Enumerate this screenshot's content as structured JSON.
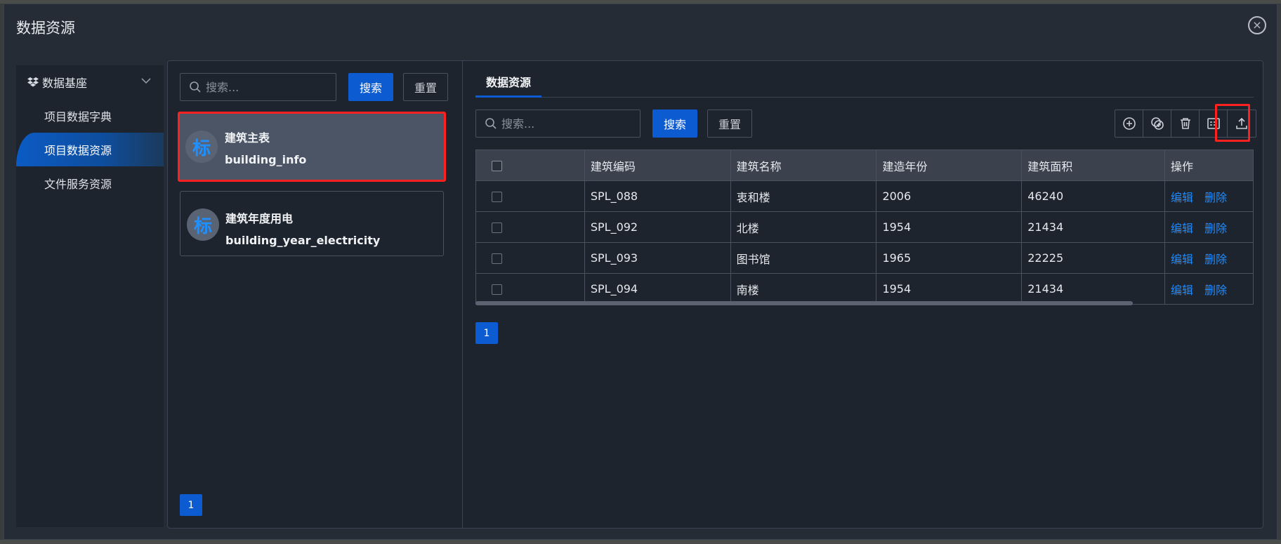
{
  "window": {
    "title": "数据资源",
    "close_glyph": "×"
  },
  "sidebar": {
    "group": {
      "label": "数据基座",
      "icon": "dropbox-icon"
    },
    "items": [
      {
        "label": "项目数据字典"
      },
      {
        "label": "项目数据资源"
      },
      {
        "label": "文件服务资源"
      }
    ]
  },
  "list_panel": {
    "search": {
      "placeholder": "搜索..."
    },
    "search_button": "搜索",
    "reset_button": "重置",
    "cards": [
      {
        "avatar": "标",
        "title": "建筑主表",
        "subtitle": "building_info"
      },
      {
        "avatar": "标",
        "title": "建筑年度用电",
        "subtitle": "building_year_electricity"
      }
    ],
    "page": "1"
  },
  "main": {
    "tab": "数据资源",
    "search": {
      "placeholder": "搜索..."
    },
    "search_button": "搜索",
    "reset_button": "重置",
    "toolbar_icons": [
      "add-circle-icon",
      "add-copy-icon",
      "trash-icon",
      "form-icon",
      "upload-icon"
    ],
    "table": {
      "columns": [
        "建筑编码",
        "建筑名称",
        "建造年份",
        "建筑面积",
        "操作"
      ],
      "rows": [
        {
          "code": "SPL_088",
          "name": "衷和楼",
          "year": "2006",
          "area": "46240"
        },
        {
          "code": "SPL_092",
          "name": "北楼",
          "year": "1954",
          "area": "21434"
        },
        {
          "code": "SPL_093",
          "name": "图书馆",
          "year": "1965",
          "area": "22225"
        },
        {
          "code": "SPL_094",
          "name": "南楼",
          "year": "1954",
          "area": "21434"
        }
      ],
      "edit_label": "编辑",
      "delete_label": "删除"
    },
    "page": "1"
  },
  "colors": {
    "accent": "#0d5bd0",
    "highlight": "#ff2020",
    "link": "#1e8bff"
  }
}
